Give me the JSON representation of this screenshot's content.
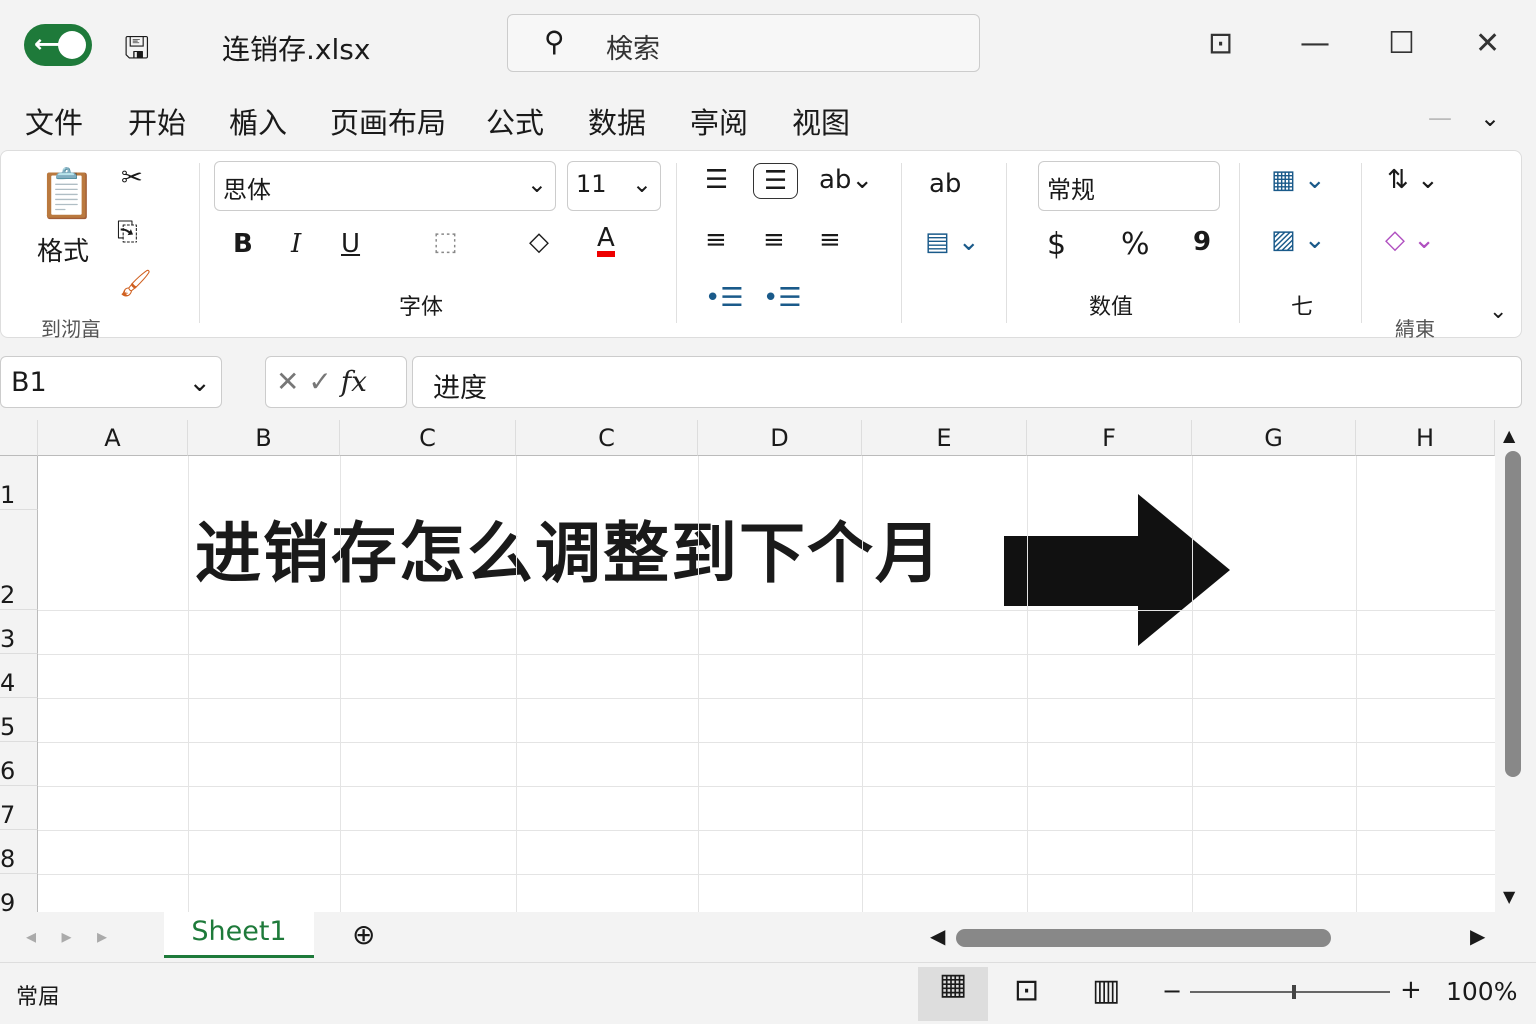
{
  "titlebar": {
    "filename": "连销存.xlsx",
    "search_placeholder": "検索"
  },
  "tabs": [
    "文件",
    "开始",
    "楯入",
    "页画布局",
    "公式",
    "数据",
    "亭阅",
    "视图"
  ],
  "ribbon": {
    "paste_label": "格式",
    "clipboard_label": "到沏畗",
    "font_name": "思体",
    "font_size": "11",
    "font_group": "字体",
    "number_format": "常规",
    "number_group": "数值",
    "styles_group": "七",
    "editing_group": "綪東",
    "bold": "B",
    "italic": "I",
    "underline": "U",
    "font_color": "A",
    "currency": "$",
    "percent": "%",
    "comma": "9"
  },
  "formula_bar": {
    "cell": "B1",
    "fx": "fx",
    "value": "进度"
  },
  "columns": [
    "A",
    "B",
    "C",
    "C",
    "D",
    "E",
    "F",
    "G",
    "H"
  ],
  "rows": [
    "1",
    "2",
    "3",
    "4",
    "5",
    "6",
    "7",
    "8",
    "9"
  ],
  "cell_content": "进销存怎么调整到下个月",
  "sheet_tab": "Sheet1",
  "status": {
    "mode": "常屇",
    "zoom": "100%"
  },
  "colors": {
    "accent": "#1e7a3a"
  }
}
